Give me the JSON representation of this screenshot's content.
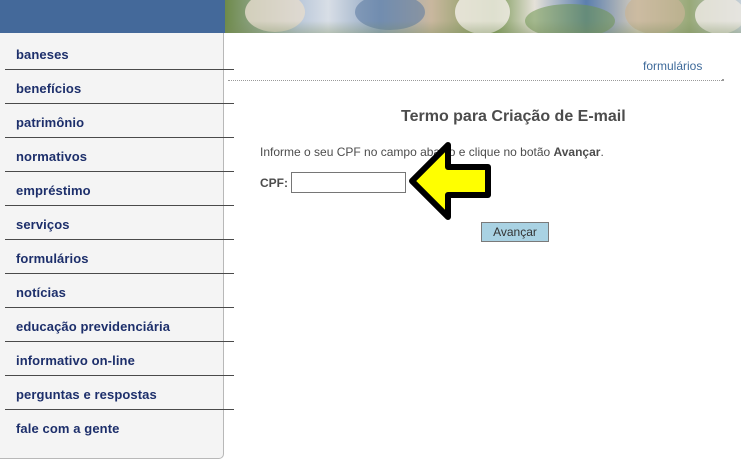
{
  "header": {
    "photo_icon": "header-banner-photo"
  },
  "sidebar": {
    "items": [
      {
        "label": "baneses"
      },
      {
        "label": "benefícios"
      },
      {
        "label": "patrimônio"
      },
      {
        "label": "normativos"
      },
      {
        "label": "empréstimo"
      },
      {
        "label": "serviços"
      },
      {
        "label": "formulários"
      },
      {
        "label": "notícias"
      },
      {
        "label": "educação previdenciária"
      },
      {
        "label": "informativo on-line"
      },
      {
        "label": "perguntas e respostas"
      },
      {
        "label": "fale com a gente"
      }
    ]
  },
  "breadcrumb": {
    "current": "formulários"
  },
  "main": {
    "title": "Termo para Criação de E-mail",
    "instruction_before": "Informe o seu CPF no campo abaixo e clique no botão ",
    "instruction_bold": "Avançar",
    "instruction_after": ".",
    "cpf_label": "CPF:",
    "cpf_value": "",
    "submit_label": "Avançar"
  },
  "annotation": {
    "arrow_icon": "yellow-arrow-left-icon",
    "arrow_fill": "#ffff00",
    "arrow_stroke": "#000000"
  },
  "colors": {
    "header_blue": "#44699a",
    "nav_text": "#1d2f6b",
    "button_bg": "#a9d2e3",
    "link": "#3e6a9a"
  }
}
